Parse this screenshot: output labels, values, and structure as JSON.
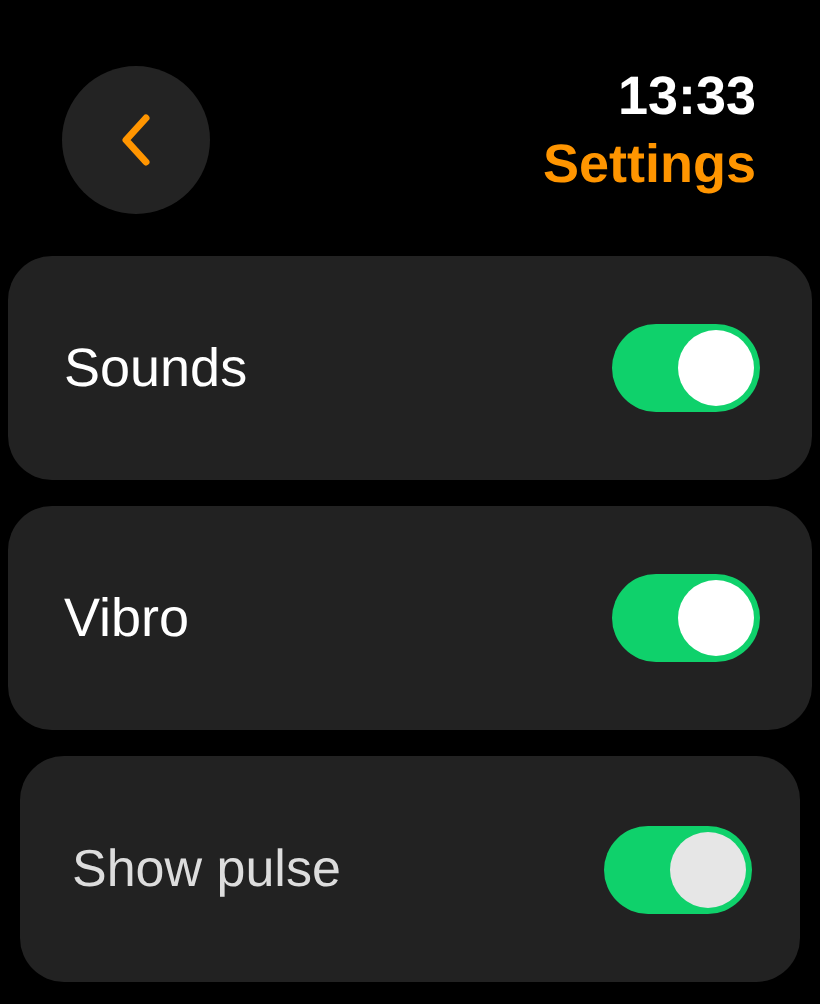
{
  "header": {
    "time": "13:33",
    "title": "Settings"
  },
  "rows": [
    {
      "label": "Sounds",
      "on": true
    },
    {
      "label": "Vibro",
      "on": true
    },
    {
      "label": "Show pulse",
      "on": true
    }
  ]
}
